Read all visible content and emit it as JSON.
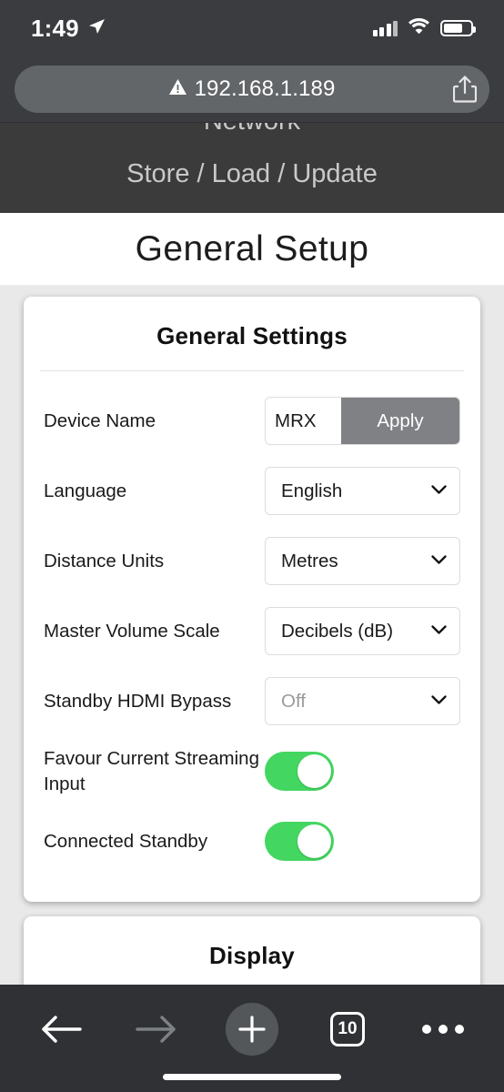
{
  "status_bar": {
    "time": "1:49",
    "location_icon": "location-arrow-icon",
    "signal_icon": "cellular-signal-icon",
    "wifi_icon": "wifi-icon",
    "battery_icon": "battery-icon",
    "battery_level": "70%"
  },
  "browser": {
    "url": "192.168.1.189",
    "security_icon": "not-secure-warning-icon",
    "share_icon": "share-icon",
    "toolbar": {
      "back_icon": "back-arrow-icon",
      "forward_icon": "forward-arrow-icon",
      "new_tab_icon": "plus-icon",
      "tab_count": "10",
      "more_icon": "more-ellipsis-icon"
    }
  },
  "site_nav": {
    "items": [
      {
        "label": "Network"
      },
      {
        "label": "Store / Load / Update"
      }
    ]
  },
  "page": {
    "title": "General Setup"
  },
  "cards": [
    {
      "title": "General Settings",
      "rows": [
        {
          "label": "Device Name",
          "type": "text-with-button",
          "value": "MRX",
          "button_label": "Apply"
        },
        {
          "label": "Language",
          "type": "select",
          "value": "English",
          "disabled": false
        },
        {
          "label": "Distance Units",
          "type": "select",
          "value": "Metres",
          "disabled": false
        },
        {
          "label": "Master Volume Scale",
          "type": "select",
          "value": "Decibels (dB)",
          "disabled": false
        },
        {
          "label": "Standby HDMI Bypass",
          "type": "select",
          "value": "Off",
          "disabled": true
        },
        {
          "label": "Favour Current Streaming Input",
          "type": "toggle",
          "value": "on"
        },
        {
          "label": "Connected Standby",
          "type": "toggle",
          "value": "on"
        }
      ]
    },
    {
      "title": "Display",
      "rows": []
    }
  ],
  "colors": {
    "toggle_on": "#43d660",
    "apply_button": "#7f8184",
    "browser_chrome": "#3a3c3f",
    "toolbar": "#2f3134",
    "site_nav": "#3b3b3b"
  }
}
